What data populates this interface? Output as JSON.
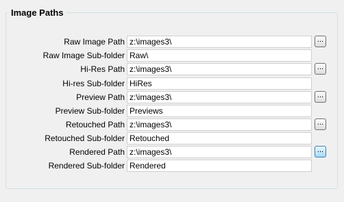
{
  "group": {
    "title": "Image Paths"
  },
  "rows": [
    {
      "label": "Raw Image Path",
      "value": "z:\\images3\\",
      "browse": "..."
    },
    {
      "label": "Raw Image Sub-folder",
      "value": "Raw\\"
    },
    {
      "label": "Hi-Res Path",
      "value": "z:\\images3\\",
      "browse": "..."
    },
    {
      "label": "Hi-res Sub-folder",
      "value": "HiRes"
    },
    {
      "label": "Preview Path",
      "value": "z:\\images3\\",
      "browse": "..."
    },
    {
      "label": "Preview Sub-folder",
      "value": "Previews"
    },
    {
      "label": "Retouched Path",
      "value": "z:\\images3\\",
      "browse": "..."
    },
    {
      "label": "Retouched Sub-folder",
      "value": "Retouched"
    },
    {
      "label": "Rendered Path",
      "value": "z:\\images3\\",
      "browse": "..."
    },
    {
      "label": "Rendered Sub-folder",
      "value": "Rendered"
    }
  ]
}
